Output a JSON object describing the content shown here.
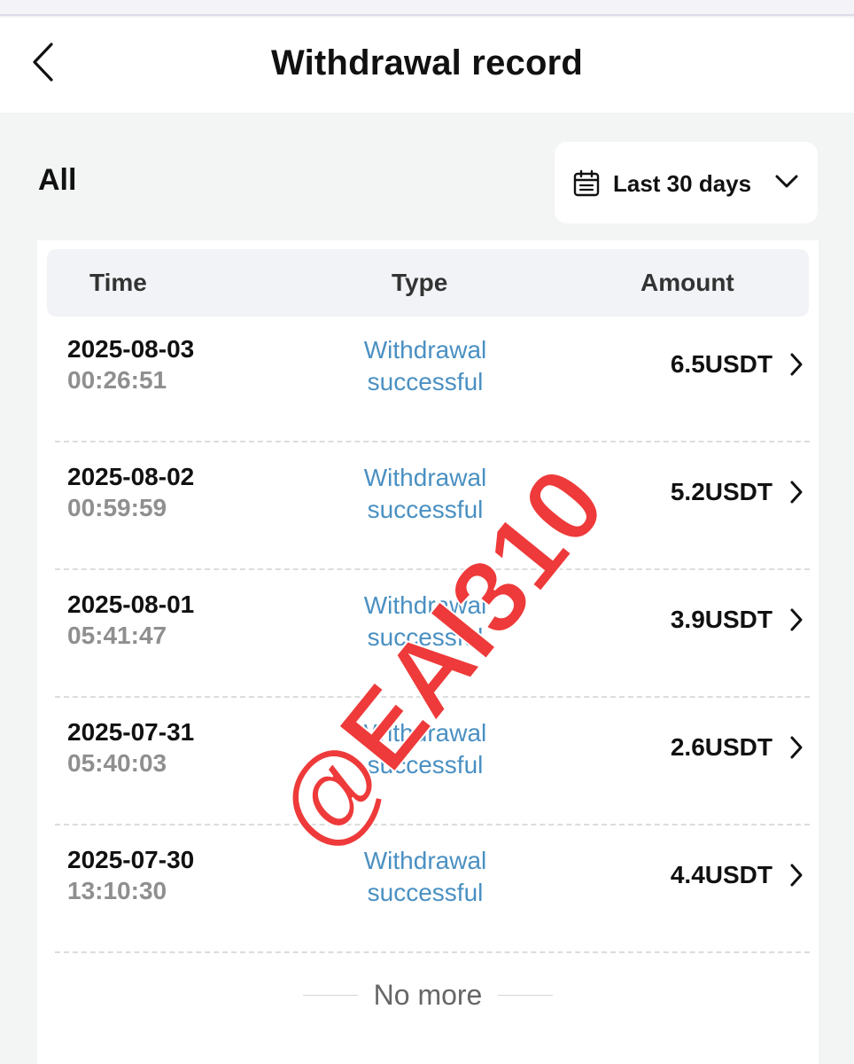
{
  "header": {
    "title": "Withdrawal record",
    "back_icon": "chevron-left-icon"
  },
  "filters": {
    "type_label": "All",
    "date_range": "Last 30 days",
    "calendar_icon": "calendar-icon",
    "dropdown_icon": "chevron-down-icon"
  },
  "table": {
    "columns": [
      "Time",
      "Type",
      "Amount"
    ],
    "rows": [
      {
        "date": "2025-08-03",
        "time": "00:26:51",
        "type_line1": "Withdrawal",
        "type_line2": "successful",
        "amount": "6.5USDT"
      },
      {
        "date": "2025-08-02",
        "time": "00:59:59",
        "type_line1": "Withdrawal",
        "type_line2": "successful",
        "amount": "5.2USDT"
      },
      {
        "date": "2025-08-01",
        "time": "05:41:47",
        "type_line1": "Withdrawal",
        "type_line2": "successful",
        "amount": "3.9USDT"
      },
      {
        "date": "2025-07-31",
        "time": "05:40:03",
        "type_line1": "Withdrawal",
        "type_line2": "successful",
        "amount": "2.6USDT"
      },
      {
        "date": "2025-07-30",
        "time": "13:10:30",
        "type_line1": "Withdrawal",
        "type_line2": "successful",
        "amount": "4.4USDT"
      }
    ]
  },
  "footer": {
    "no_more": "No more"
  },
  "watermark": "@EAI310",
  "colors": {
    "status_blue": "#4a90c2",
    "watermark_red": "#ee3a3a",
    "background": "#f3f4f4"
  }
}
